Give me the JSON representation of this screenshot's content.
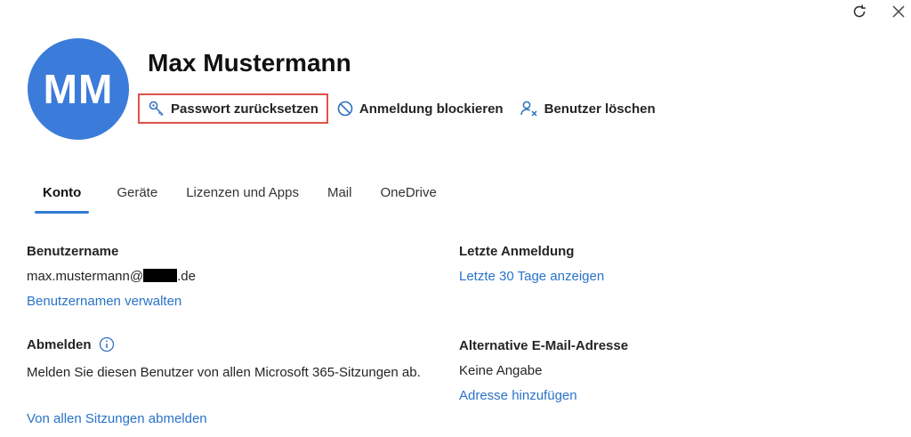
{
  "window": {
    "refresh_icon": "refresh-icon",
    "close_icon": "close-icon"
  },
  "user": {
    "initials": "MM",
    "name": "Max Mustermann",
    "avatar_color": "#3b7bd9"
  },
  "actions": [
    {
      "label": "Passwort zurücksetzen",
      "icon": "key-icon"
    },
    {
      "label": "Anmeldung blockieren",
      "icon": "block-icon"
    },
    {
      "label": "Benutzer löschen",
      "icon": "delete-user-icon"
    }
  ],
  "tabs": [
    {
      "label": "Konto",
      "active": true
    },
    {
      "label": "Geräte"
    },
    {
      "label": "Lizenzen und Apps"
    },
    {
      "label": "Mail"
    },
    {
      "label": "OneDrive"
    }
  ],
  "account": {
    "username_label": "Benutzername",
    "username_prefix": "max.mustermann@",
    "username_suffix": ".de",
    "manage_usernames_link": "Benutzernamen verwalten",
    "signout_label": "Abmelden",
    "signout_description": "Melden Sie diesen Benutzer von allen Microsoft 365-Sitzungen ab.",
    "signout_link": "Von allen Sitzungen abmelden",
    "last_signin_label": "Letzte Anmeldung",
    "last_signin_link": "Letzte 30 Tage anzeigen",
    "alt_email_label": "Alternative E-Mail-Adresse",
    "alt_email_value": "Keine Angabe",
    "alt_email_link": "Adresse hinzufügen"
  },
  "colors": {
    "accent": "#2e7bd3",
    "link": "#2a72c8",
    "highlight_border": "#e0524a"
  }
}
